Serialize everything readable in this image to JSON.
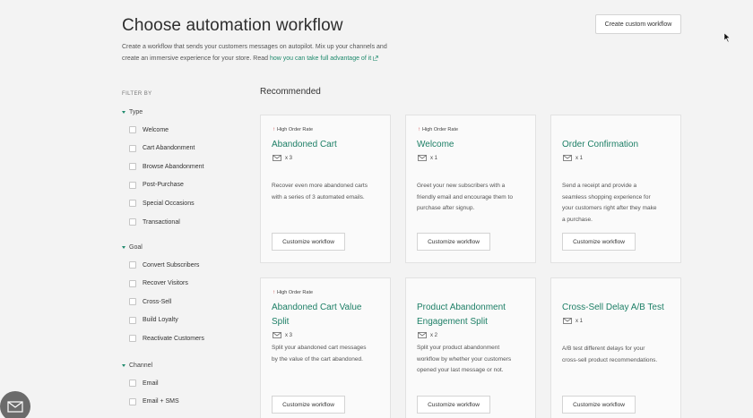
{
  "header": {
    "title": "Choose automation workflow",
    "create_button": "Create custom workflow",
    "description_line1": "Create a workflow that sends your customers messages on autopilot. Mix up your channels and",
    "description_line2": "create an immersive experience for your store. Read ",
    "description_link": "how you can take full advantage of it"
  },
  "sidebar": {
    "filter_by": "FILTER BY",
    "groups": [
      {
        "label": "Type",
        "items": [
          "Welcome",
          "Cart Abandonment",
          "Browse Abandonment",
          "Post-Purchase",
          "Special Occasions",
          "Transactional"
        ]
      },
      {
        "label": "Goal",
        "items": [
          "Convert Subscribers",
          "Recover Visitors",
          "Cross-Sell",
          "Build Loyalty",
          "Reactivate Customers"
        ]
      },
      {
        "label": "Channel",
        "items": [
          "Email",
          "Email + SMS"
        ]
      }
    ]
  },
  "main": {
    "section_title": "Recommended",
    "cards": [
      {
        "badge": "High Order Rate",
        "title_lines": [
          "Abandoned Cart"
        ],
        "count": "x 3",
        "desc_lines": [
          "Recover even more abandoned carts",
          "with a series of 3 automated emails."
        ],
        "button": "Customize workflow"
      },
      {
        "badge": "High Order Rate",
        "title_lines": [
          "Welcome"
        ],
        "count": "x 1",
        "desc_lines": [
          "Greet your new subscribers with a",
          "friendly email and encourage them to",
          "purchase after signup."
        ],
        "button": "Customize workflow"
      },
      {
        "badge": "",
        "title_lines": [
          "Order Confirmation"
        ],
        "count": "x 1",
        "desc_lines": [
          "Send a receipt and provide a",
          "seamless shopping experience for",
          "your customers right after they make",
          "a purchase."
        ],
        "button": "Customize workflow"
      },
      {
        "badge": "High Order Rate",
        "title_lines": [
          "Abandoned Cart Value",
          "Split"
        ],
        "count": "x 3",
        "desc_lines": [
          "Split your abandoned cart messages",
          "by the value of the cart abandoned."
        ],
        "button": "Customize workflow"
      },
      {
        "badge": "",
        "title_lines": [
          "Product Abandonment",
          "Engagement Split"
        ],
        "count": "x 2",
        "desc_lines": [
          "Split your product abandonment",
          "workflow by whether your customers",
          "opened your last message or not."
        ],
        "button": "Customize workflow"
      },
      {
        "badge": "",
        "title_lines": [
          "Cross-Sell Delay A/B Test"
        ],
        "count": "x 1",
        "desc_lines": [
          "A/B test different delays for your",
          "cross-sell product recommendations."
        ],
        "button": "Customize workflow"
      }
    ]
  },
  "colors": {
    "accent": "#1d7f66",
    "badge_arrow": "#cc4444"
  },
  "icons": [
    "mail-icon",
    "up-arrow-icon",
    "external-link-icon",
    "chat-icon",
    "cursor-icon"
  ]
}
